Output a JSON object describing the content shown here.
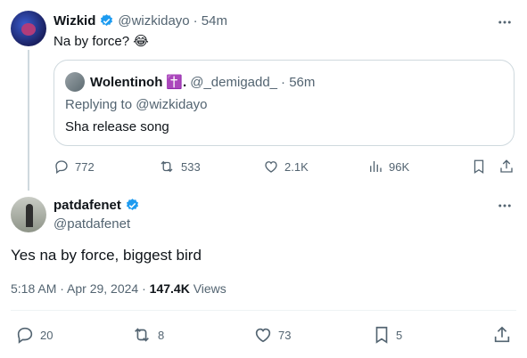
{
  "parent": {
    "name": "Wizkid",
    "handle": "@wizkidayo",
    "time": "· 54m",
    "text": "Na by force? 😂",
    "quote": {
      "name": "Wolentinoh",
      "badge": "✝️.",
      "handle": "@_demigadd_",
      "time": "· 56m",
      "replying": "Replying to ",
      "replying_handle": "@wizkidayo",
      "text": "Sha release song"
    },
    "actions": {
      "replies": "772",
      "reposts": "533",
      "likes": "2.1K",
      "views": "96K"
    }
  },
  "reply": {
    "name": "patdafenet",
    "handle": "@patdafenet",
    "text": "Yes na by force, biggest bird",
    "timestamp": "5:18 AM · Apr 29, 2024 · ",
    "views_count": "147.4K",
    "views_label": " Views",
    "actions": {
      "replies": "20",
      "reposts": "8",
      "likes": "73",
      "bookmarks": "5"
    }
  },
  "colors": {
    "verified": "#1d9bf0",
    "text": "#0f1419",
    "secondary": "#536471",
    "border": "#cfd9de"
  },
  "icons": [
    "more-icon",
    "verified-icon",
    "reply-icon",
    "repost-icon",
    "like-icon",
    "views-icon",
    "bookmark-icon",
    "share-icon"
  ]
}
